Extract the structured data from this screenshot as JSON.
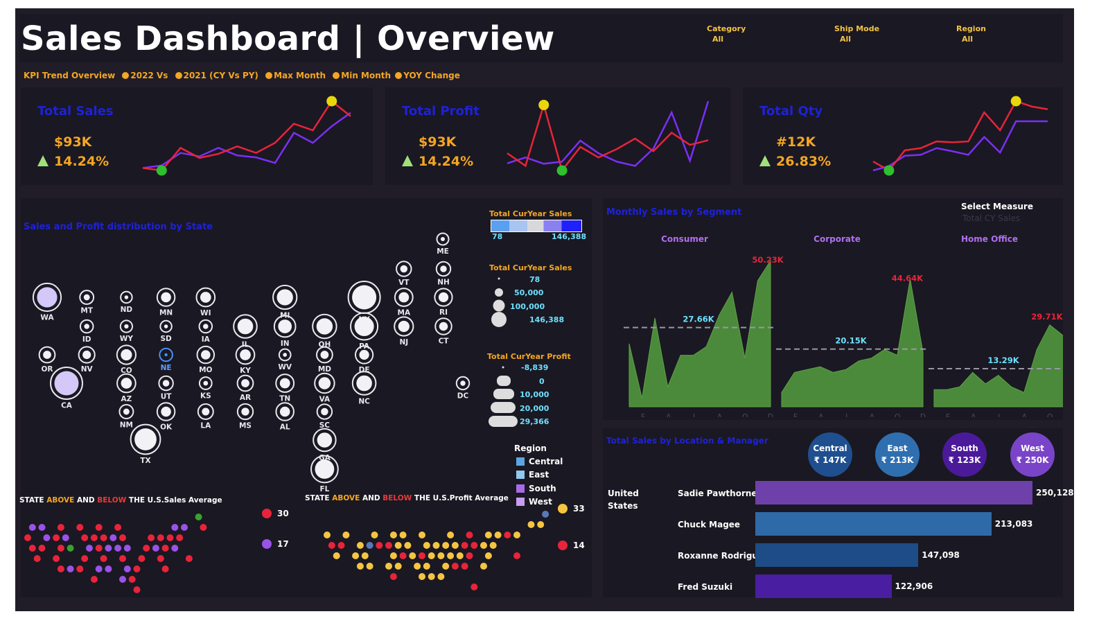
{
  "header": {
    "title": "Sales Dashboard | Overview",
    "filters": [
      {
        "label": "Category",
        "value": "All"
      },
      {
        "label": "Ship Mode",
        "value": "All"
      },
      {
        "label": "Region",
        "value": "All"
      }
    ],
    "kpi_trend_text": [
      "KPI Trend Overview",
      "2022 Vs",
      "2021 (CY Vs PY)",
      "Max Month",
      "Min Month",
      "YOY Change"
    ]
  },
  "kpis": [
    {
      "title": "Total Sales",
      "value": "$93K",
      "change": "14.24%"
    },
    {
      "title": "Total Profit",
      "value": "$93K",
      "change": "14.24%"
    },
    {
      "title": "Total Qty",
      "value": "#12K",
      "change": "26.83%"
    }
  ],
  "map_section": {
    "title": "Sales and Profit distribution by State",
    "legend_sales_color": {
      "title": "Total CurYear Sales",
      "min": "78",
      "max": "146,388"
    },
    "legend_sales_size": {
      "title": "Total CurYear Sales",
      "items": [
        "78",
        "50,000",
        "100,000",
        "146,388"
      ]
    },
    "legend_profit": {
      "title": "Total CurYear Profit",
      "items": [
        "-8,839",
        "0",
        "10,000",
        "20,000",
        "29,366"
      ]
    },
    "legend_region": {
      "title": "Region",
      "items": [
        {
          "name": "Central",
          "color": "#5ba6e0"
        },
        {
          "name": "East",
          "color": "#8fc8f0"
        },
        {
          "name": "South",
          "color": "#a96ae8"
        },
        {
          "name": "West",
          "color": "#c89cf0"
        }
      ]
    },
    "sales_avg": {
      "title_pre": "STATE ",
      "above": "ABOVE",
      "and": " AND ",
      "below": "BELOW",
      "title_post": " THE U.S.Sales Average",
      "counts": [
        {
          "value": "30",
          "color": "#e8243a"
        },
        {
          "value": "17",
          "color": "#9a52e8"
        }
      ]
    },
    "profit_avg": {
      "title_pre": "STATE ",
      "above": "ABOVE",
      "and": " AND ",
      "below": "BELOW",
      "title_post": " THE U.S.Profit Average",
      "counts": [
        {
          "value": "33",
          "color": "#f5c542"
        },
        {
          "value": "14",
          "color": "#e8243a"
        }
      ]
    }
  },
  "segment_section": {
    "title": "Monthly Sales by Segment",
    "select_label": "Select Measure",
    "select_value": "Total CY Sales",
    "segments": [
      "Consumer",
      "Corporate",
      "Home Office"
    ]
  },
  "manager_section": {
    "title": "Total Sales by Location & Manager",
    "country": "United States",
    "regions": [
      {
        "name": "Central",
        "value": "₹ 147K",
        "color": "#1f4f8f"
      },
      {
        "name": "East",
        "value": "₹ 213K",
        "color": "#2f6fb0"
      },
      {
        "name": "South",
        "value": "₹ 123K",
        "color": "#4a1a9a"
      },
      {
        "name": "West",
        "value": "₹ 250K",
        "color": "#7a44c8"
      }
    ],
    "managers": [
      {
        "name": "Sadie Pawthorne",
        "label": "250,128",
        "color": "#6e40aa"
      },
      {
        "name": "Chuck Magee",
        "label": "213,083",
        "color": "#2e6aa8"
      },
      {
        "name": "Roxanne Rodriguez",
        "label": "147,098",
        "color": "#1e4c86"
      },
      {
        "name": "Fred Suzuki",
        "label": "122,906",
        "color": "#4a1ea0"
      }
    ]
  },
  "chart_data": [
    {
      "type": "line",
      "title": "Total Sales",
      "series": [
        {
          "name": "2022",
          "color": "#e8243a",
          "values": [
            3.5,
            3.0,
            7.5,
            5.5,
            6.3,
            7.8,
            6.5,
            8.5,
            12.3,
            11.0,
            16.8,
            13.8
          ]
        },
        {
          "name": "2021",
          "color": "#7b2ff7",
          "values": [
            3.5,
            4.0,
            6.5,
            5.8,
            7.5,
            6.0,
            5.6,
            4.5,
            10.5,
            8.5,
            11.8,
            14.5
          ]
        }
      ]
    },
    {
      "type": "line",
      "title": "Total Profit",
      "series": [
        {
          "name": "2022",
          "color": "#e8243a",
          "values": [
            6.3,
            3.3,
            17.8,
            2.2,
            7.8,
            5.3,
            7.3,
            9.8,
            6.8,
            11.2,
            8.3,
            9.4
          ]
        },
        {
          "name": "2021",
          "color": "#7b2ff7",
          "values": [
            3.9,
            5.3,
            3.8,
            4.3,
            9.3,
            6.3,
            4.3,
            3.3,
            7.4,
            16.0,
            4.5,
            18.7
          ]
        }
      ]
    },
    {
      "type": "line",
      "title": "Total Qty",
      "series": [
        {
          "name": "2022",
          "color": "#e8243a",
          "values": [
            4.5,
            2.5,
            7.0,
            7.5,
            9.0,
            8.8,
            9.0,
            15.5,
            11.5,
            18.0,
            16.8,
            16.2
          ]
        },
        {
          "name": "2021",
          "color": "#7b2ff7",
          "values": [
            2.5,
            3.5,
            5.8,
            6.0,
            7.5,
            6.8,
            6.0,
            10.0,
            6.5,
            13.5,
            13.5,
            13.5
          ]
        }
      ]
    },
    {
      "type": "area",
      "title": "Monthly Sales by Segment",
      "x": [
        "J",
        "F",
        "M",
        "A",
        "M",
        "J",
        "J",
        "A",
        "S",
        "O",
        "N",
        "D"
      ],
      "x_ticks": [
        "F",
        "A",
        "J",
        "A",
        "O",
        "D"
      ],
      "series": [
        {
          "name": "Consumer",
          "values": [
            22,
            3,
            31,
            7,
            18,
            18,
            21,
            32,
            40,
            17,
            44,
            51
          ],
          "avg": 27.66,
          "avg_label": "27.66K",
          "max_label": "50.23K"
        },
        {
          "name": "Corporate",
          "values": [
            5,
            12,
            13,
            14,
            12,
            13,
            16,
            17,
            20,
            18,
            44.6,
            19
          ],
          "avg": 20.15,
          "avg_label": "20.15K",
          "max_label": "44.64K"
        },
        {
          "name": "Home Office",
          "values": [
            6,
            6,
            7,
            12,
            8,
            11,
            7,
            5,
            20,
            28.6,
            25,
            9
          ],
          "avg": 13.29,
          "avg_label": "13.29K",
          "max_label": "29.71K"
        }
      ],
      "ylim": [
        0,
        52
      ]
    },
    {
      "type": "bar",
      "title": "Total Sales by Location & Manager",
      "categories": [
        "Sadie Pawthorne",
        "Chuck Magee",
        "Roxanne Rodriguez",
        "Fred Suzuki"
      ],
      "values": [
        250128,
        213083,
        147098,
        122906
      ]
    },
    {
      "type": "scatter",
      "title": "Sales and Profit distribution by State",
      "states": [
        {
          "id": "ME",
          "sales": 1300,
          "region": "East"
        },
        {
          "id": "VT",
          "sales": 8000,
          "region": "East"
        },
        {
          "id": "NH",
          "sales": 6000,
          "region": "East"
        },
        {
          "id": "WA",
          "sales": 98000,
          "region": "West"
        },
        {
          "id": "MT",
          "sales": 4800,
          "region": "West"
        },
        {
          "id": "ND",
          "sales": 900,
          "region": "Central"
        },
        {
          "id": "MN",
          "sales": 19000,
          "region": "Central"
        },
        {
          "id": "WI",
          "sales": 23000,
          "region": "Central"
        },
        {
          "id": "MI",
          "sales": 59000,
          "region": "Central"
        },
        {
          "id": "NY",
          "sales": 146388,
          "region": "East"
        },
        {
          "id": "MA",
          "sales": 20000,
          "region": "East"
        },
        {
          "id": "RI",
          "sales": 18000,
          "region": "East"
        },
        {
          "id": "ID",
          "sales": 3000,
          "region": "West"
        },
        {
          "id": "WY",
          "sales": 1500,
          "region": "West"
        },
        {
          "id": "SD",
          "sales": 900,
          "region": "Central"
        },
        {
          "id": "IA",
          "sales": 3000,
          "region": "Central"
        },
        {
          "id": "IL",
          "sales": 55000,
          "region": "Central"
        },
        {
          "id": "IN",
          "sales": 40000,
          "region": "Central"
        },
        {
          "id": "OH",
          "sales": 60000,
          "region": "East"
        },
        {
          "id": "PA",
          "sales": 90000,
          "region": "East"
        },
        {
          "id": "NJ",
          "sales": 25000,
          "region": "East"
        },
        {
          "id": "CT",
          "sales": 13000,
          "region": "East"
        },
        {
          "id": "OR",
          "sales": 11000,
          "region": "West"
        },
        {
          "id": "NV",
          "sales": 12000,
          "region": "West"
        },
        {
          "id": "CO",
          "sales": 25000,
          "region": "West"
        },
        {
          "id": "NE",
          "sales": 3000,
          "region": "Central"
        },
        {
          "id": "MO",
          "sales": 16000,
          "region": "Central"
        },
        {
          "id": "KY",
          "sales": 23000,
          "region": "South"
        },
        {
          "id": "WV",
          "sales": 1000,
          "region": "East"
        },
        {
          "id": "MD",
          "sales": 11000,
          "region": "East"
        },
        {
          "id": "DE",
          "sales": 18000,
          "region": "East"
        },
        {
          "id": "CA",
          "sales": 146000,
          "region": "West"
        },
        {
          "id": "AZ",
          "sales": 23000,
          "region": "West"
        },
        {
          "id": "UT",
          "sales": 6000,
          "region": "West"
        },
        {
          "id": "KS",
          "sales": 2000,
          "region": "Central"
        },
        {
          "id": "AR",
          "sales": 11000,
          "region": "South"
        },
        {
          "id": "TN",
          "sales": 20000,
          "region": "South"
        },
        {
          "id": "VA",
          "sales": 30000,
          "region": "South"
        },
        {
          "id": "NC",
          "sales": 55000,
          "region": "South"
        },
        {
          "id": "DC",
          "sales": 2800,
          "region": "East"
        },
        {
          "id": "NM",
          "sales": 5000,
          "region": "West"
        },
        {
          "id": "OK",
          "sales": 19000,
          "region": "Central"
        },
        {
          "id": "LA",
          "sales": 9000,
          "region": "South"
        },
        {
          "id": "MS",
          "sales": 10000,
          "region": "South"
        },
        {
          "id": "AL",
          "sales": 19000,
          "region": "South"
        },
        {
          "id": "SC",
          "sales": 8000,
          "region": "South"
        },
        {
          "id": "GA",
          "sales": 49000,
          "region": "South"
        },
        {
          "id": "TX",
          "sales": 118000,
          "region": "Central"
        },
        {
          "id": "FL",
          "sales": 88000,
          "region": "South"
        }
      ]
    }
  ]
}
